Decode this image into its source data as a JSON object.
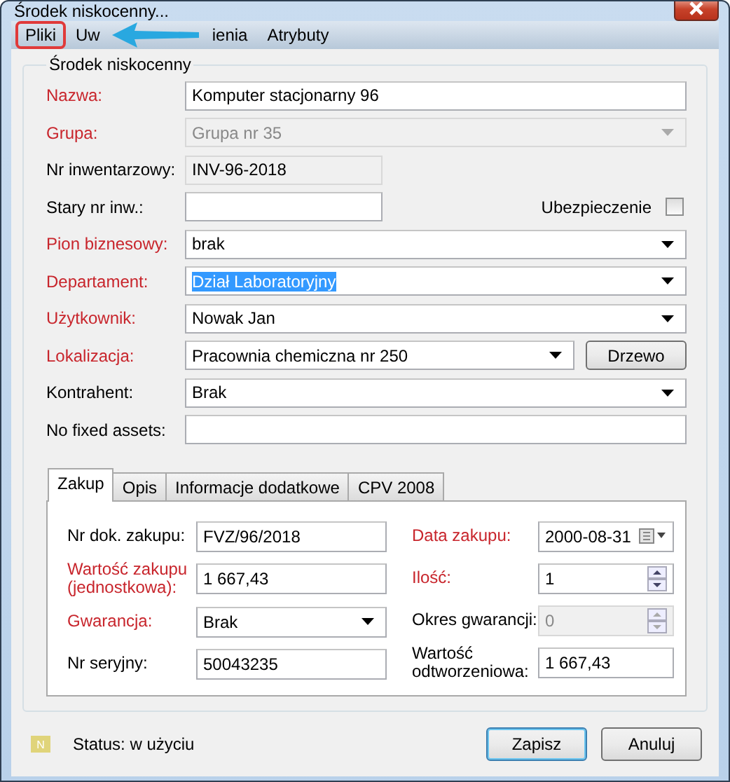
{
  "window": {
    "title": "Środek niskocenny..."
  },
  "menu": [
    {
      "label": "Pliki",
      "highlighted": true
    },
    {
      "label": "Uw",
      "highlighted": false
    },
    {
      "label": "ienia",
      "highlighted": false
    },
    {
      "label": "Atrybuty",
      "highlighted": false
    }
  ],
  "annotation": {
    "kind": "arrow"
  },
  "group": {
    "title": "Środek niskocenny",
    "fields": [
      {
        "kind": "text",
        "label": "Nazwa:",
        "required": true,
        "value": "Komputer stacjonarny 96"
      },
      {
        "kind": "combo",
        "label": "Grupa:",
        "required": true,
        "value": "Grupa nr 35",
        "disabled": true,
        "focused": false
      },
      {
        "kind": "readonly",
        "label": "Nr inwentarzowy:",
        "required": false,
        "value": "INV-96-2018"
      },
      {
        "kind": "short",
        "label": "Stary nr inw.:",
        "required": false,
        "checkbox": {
          "label": "Ubezpieczenie",
          "checked": false
        }
      },
      {
        "kind": "combo",
        "label": "Pion biznesowy:",
        "required": true,
        "value": "brak",
        "disabled": false,
        "focused": false
      },
      {
        "kind": "combo",
        "label": "Departament:",
        "required": true,
        "value": "Dział Laboratoryjny",
        "disabled": false,
        "focused": true
      },
      {
        "kind": "combo",
        "label": "Użytkownik:",
        "required": true,
        "value": "Nowak Jan",
        "disabled": false,
        "focused": false
      },
      {
        "kind": "combo",
        "label": "Lokalizacja:",
        "required": true,
        "value": "Pracownia chemiczna nr 250",
        "disabled": false,
        "focused": false,
        "button": "Drzewo"
      },
      {
        "kind": "combo",
        "label": "Kontrahent:",
        "required": false,
        "value": "Brak",
        "disabled": false,
        "focused": false
      },
      {
        "kind": "text",
        "label": "No fixed assets:",
        "required": false
      }
    ]
  },
  "tabs": [
    {
      "label": "Zakup",
      "selected": true
    },
    {
      "label": "Opis",
      "selected": false
    },
    {
      "label": "Informacje dodatkowe",
      "selected": false
    },
    {
      "label": "CPV 2008",
      "selected": false
    }
  ],
  "purchase": {
    "left": [
      {
        "kind": "text",
        "label": "Nr dok. zakupu:",
        "required": false,
        "value": "FVZ/96/2018"
      },
      {
        "kind": "text",
        "label": "Wartość zakupu (jednostkowa):",
        "required": true,
        "value": "1 667,43"
      },
      {
        "kind": "combo",
        "label": "Gwarancja:",
        "required": true,
        "value": "Brak"
      },
      {
        "kind": "text",
        "label": "Nr seryjny:",
        "required": false,
        "value": "50043235"
      }
    ],
    "right": [
      {
        "kind": "date",
        "label": "Data zakupu:",
        "required": true,
        "value": "2000-08-31"
      },
      {
        "kind": "spin",
        "label": "Ilość:",
        "required": true,
        "value": "1",
        "disabled": false
      },
      {
        "kind": "spin",
        "label": "Okres gwarancji:",
        "required": false,
        "value": "0",
        "disabled": true
      },
      {
        "kind": "text",
        "label": "Wartość odtworzeniowa:",
        "required": false,
        "value": "1 667,43"
      }
    ]
  },
  "status": {
    "badge": "N",
    "text": "Status: w użyciu"
  },
  "buttons": [
    {
      "label": "Zapisz",
      "default": true
    },
    {
      "label": "Anuluj",
      "default": false
    }
  ]
}
